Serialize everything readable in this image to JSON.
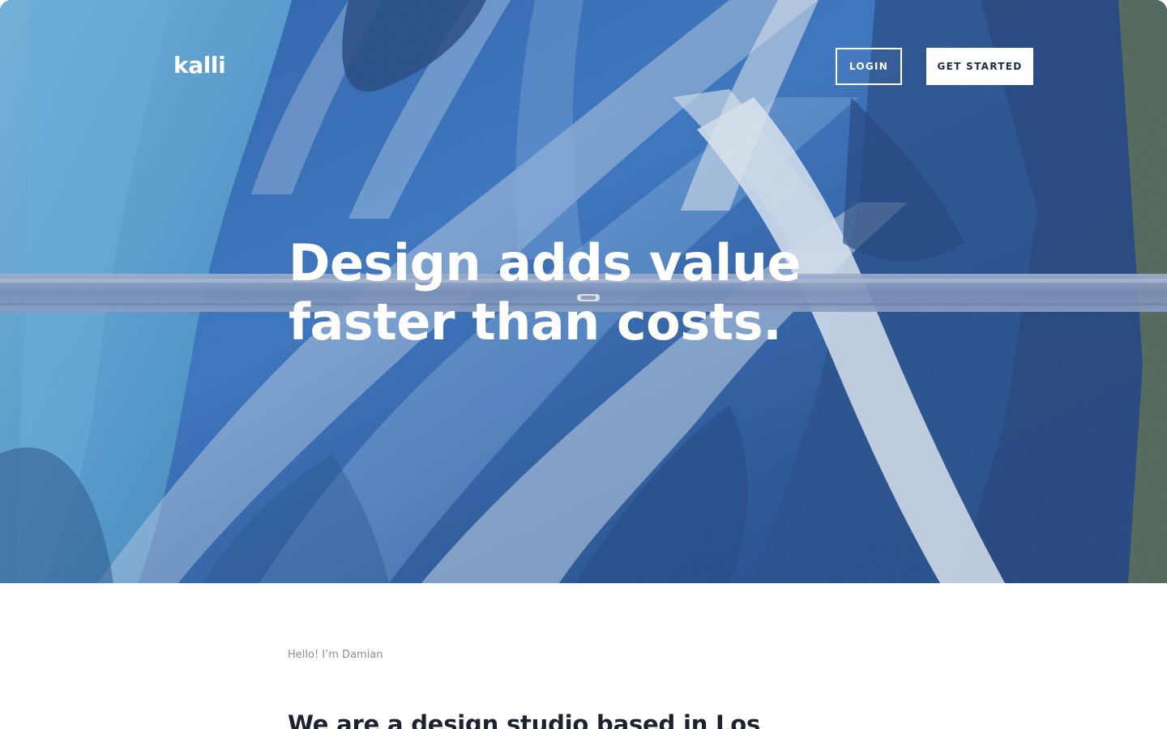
{
  "header": {
    "logo_text": "kalli",
    "login_label": "LOGIN",
    "get_started_label": "GET STARTED"
  },
  "hero": {
    "title_line_1": "Design adds value",
    "title_line_2": "faster than costs."
  },
  "intro": {
    "kicker": "Hello! I’m Damian",
    "heading": "We are a design studio based in Los"
  }
}
